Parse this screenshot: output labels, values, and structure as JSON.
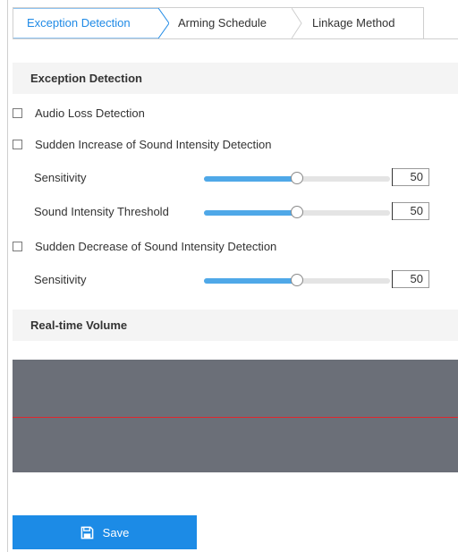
{
  "tabs": [
    {
      "label": "Exception Detection",
      "active": true
    },
    {
      "label": "Arming Schedule",
      "active": false
    },
    {
      "label": "Linkage Method",
      "active": false
    }
  ],
  "exception_section": {
    "title": "Exception Detection",
    "audio_loss": {
      "label": "Audio Loss Detection",
      "checked": false
    },
    "sudden_increase": {
      "label": "Sudden Increase of Sound Intensity Detection",
      "checked": false,
      "sensitivity": {
        "label": "Sensitivity",
        "value": "50",
        "level": 0.5
      },
      "threshold": {
        "label": "Sound Intensity Threshold",
        "value": "50",
        "level": 0.5
      }
    },
    "sudden_decrease": {
      "label": "Sudden Decrease of Sound Intensity Detection",
      "checked": false,
      "sensitivity": {
        "label": "Sensitivity",
        "value": "50",
        "level": 0.5
      }
    }
  },
  "volume_section": {
    "title": "Real-time Volume"
  },
  "save_button": {
    "label": "Save",
    "icon": "save-icon"
  },
  "colors": {
    "accent": "#1c8be6",
    "slider_fill": "#4fa8e8",
    "volume_bg": "#6b6f78",
    "volume_line": "#e0262d"
  }
}
